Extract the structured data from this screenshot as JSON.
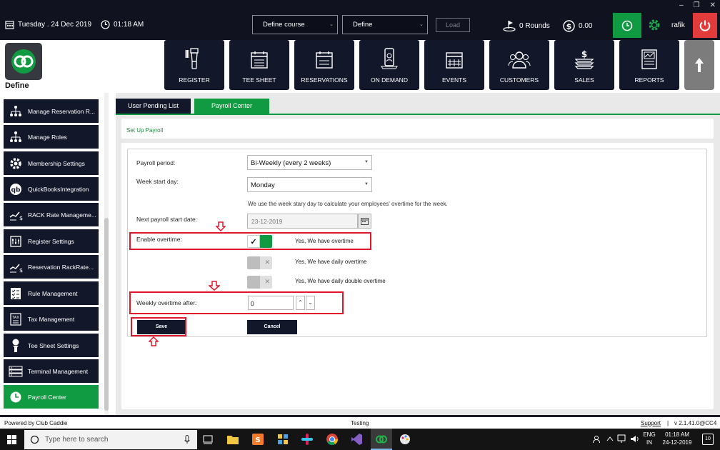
{
  "topbar": {
    "date": "Tuesday .  24 Dec 2019",
    "time": "01:18 AM",
    "course_select": "Define  course",
    "define_select": "Define",
    "load_label": "Load",
    "rounds": "0 Rounds",
    "amount": "0.00",
    "user": "rafik"
  },
  "logo": {
    "name": "Define"
  },
  "nav": [
    {
      "label": "REGISTER",
      "icon": "barcode-scanner-icon"
    },
    {
      "label": "TEE SHEET",
      "icon": "calendar-sheet-icon"
    },
    {
      "label": "RESERVATIONS",
      "icon": "calendar-icon"
    },
    {
      "label": "ON DEMAND",
      "icon": "mobile-phone-icon"
    },
    {
      "label": "EVENTS",
      "icon": "event-calendar-icon"
    },
    {
      "label": "CUSTOMERS",
      "icon": "customers-icon"
    },
    {
      "label": "SALES",
      "icon": "cash-icon"
    },
    {
      "label": "REPORTS",
      "icon": "report-icon"
    }
  ],
  "sidebar": {
    "items": [
      {
        "label": "Manage Reservation R...",
        "icon": "hierarchy-icon"
      },
      {
        "label": "Manage Roles",
        "icon": "hierarchy-icon"
      },
      {
        "label": "Membership Settings",
        "icon": "gear-icon"
      },
      {
        "label": "QuickBooksIntegration",
        "icon": "quickbooks-icon"
      },
      {
        "label": "RACK Rate Manageme...",
        "icon": "rate-icon"
      },
      {
        "label": "Register Settings",
        "icon": "register-settings-icon"
      },
      {
        "label": "Reservation RackRate...",
        "icon": "rate-icon"
      },
      {
        "label": "Rule Management",
        "icon": "checklist-icon"
      },
      {
        "label": "Tax Management",
        "icon": "tax-icon"
      },
      {
        "label": "Tee Sheet Settings",
        "icon": "golf-tee-icon"
      },
      {
        "label": "Terminal Management",
        "icon": "terminal-icon"
      },
      {
        "label": "Payroll Center",
        "icon": "clock-icon"
      }
    ]
  },
  "tabs": {
    "pending": "User Pending List",
    "payroll": "Payroll Center"
  },
  "section_title": "Set Up Payroll",
  "form": {
    "payroll_period_label": "Payroll period:",
    "payroll_period_value": "Bi-Weekly (every 2 weeks)",
    "week_start_label": "Week start day:",
    "week_start_value": "Monday",
    "week_start_hint": "We use the week stary day to calculate your employees' overtime for the week.",
    "next_start_label": "Next payroll start date:",
    "next_start_value": "23-12-2019",
    "enable_overtime_label": "Enable overtime:",
    "toggle_overtime": "Yes, We have overtime",
    "toggle_daily": "Yes, We have daily overtime",
    "toggle_double": "Yes, We have daily double overtime",
    "weekly_after_label": "Weekly overtime after:",
    "weekly_after_value": "0",
    "save_label": "Save",
    "cancel_label": "Cancel"
  },
  "status": {
    "powered": "Powered by Club Caddie",
    "env": "Testing",
    "support": "Support",
    "version": "v 2.1.41.0@CC4"
  },
  "taskbar": {
    "search_placeholder": "Type here to search",
    "lang1": "ENG",
    "lang2": "IN",
    "clock_time": "01:18 AM",
    "clock_date": "24-12-2019",
    "notif": "10"
  },
  "colors": {
    "accent": "#109a41",
    "navy": "#13172a",
    "highlight": "#e0162b",
    "power": "#e23b3b"
  }
}
